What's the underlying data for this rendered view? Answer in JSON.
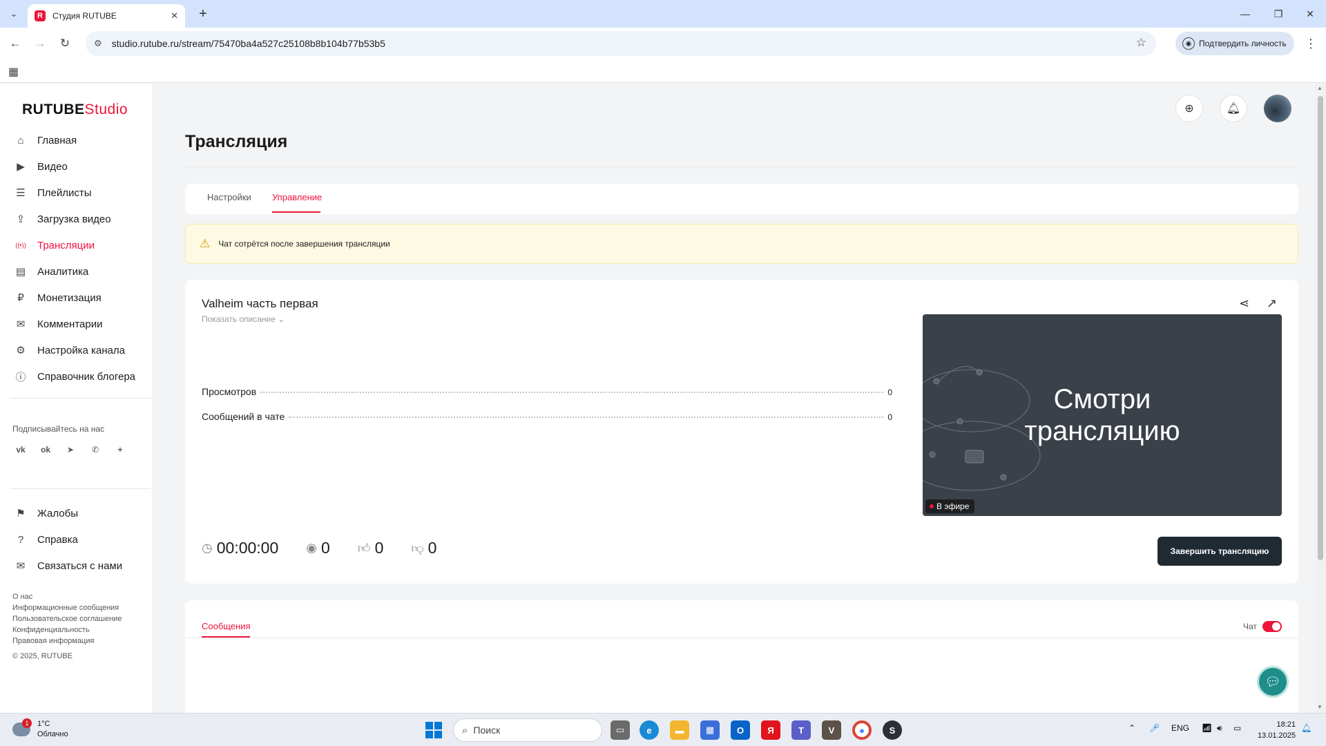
{
  "browser": {
    "tab_title": "Студия RUTUBE",
    "tab_favicon": "R",
    "url": "studio.rutube.ru/stream/75470ba4a527c25108b8b104b77b53b5",
    "verify_label": "Подтвердить личность"
  },
  "logo": {
    "brand": "RUTUBE",
    "product": "Studio"
  },
  "sidebar": {
    "items": [
      {
        "label": "Главная",
        "icon": "home-icon",
        "glyph": "⌂"
      },
      {
        "label": "Видео",
        "icon": "video-icon",
        "glyph": "▶"
      },
      {
        "label": "Плейлисты",
        "icon": "playlist-icon",
        "glyph": "☰"
      },
      {
        "label": "Загрузка видео",
        "icon": "upload-icon",
        "glyph": "⇪"
      },
      {
        "label": "Трансляции",
        "icon": "broadcast-icon",
        "glyph": "((•))"
      },
      {
        "label": "Аналитика",
        "icon": "analytics-icon",
        "glyph": "▤"
      },
      {
        "label": "Монетизация",
        "icon": "ruble-icon",
        "glyph": "₽"
      },
      {
        "label": "Комментарии",
        "icon": "comments-icon",
        "glyph": "✉"
      },
      {
        "label": "Настройка канала",
        "icon": "gear-icon",
        "glyph": "⚙"
      },
      {
        "label": "Справочник блогера",
        "icon": "info-icon",
        "glyph": "ⓘ"
      }
    ],
    "active_index": 4,
    "follow_label": "Подписывайтесь на нас",
    "socials": [
      {
        "icon": "vk-icon",
        "glyph": "vk"
      },
      {
        "icon": "ok-icon",
        "glyph": "ok"
      },
      {
        "icon": "telegram-icon",
        "glyph": "➤"
      },
      {
        "icon": "viber-icon",
        "glyph": "✆"
      },
      {
        "icon": "plus-icon",
        "glyph": "+"
      }
    ],
    "secondary": [
      {
        "label": "Жалобы",
        "icon": "flag-icon",
        "glyph": "⚑"
      },
      {
        "label": "Справка",
        "icon": "help-icon",
        "glyph": "?"
      },
      {
        "label": "Связаться с нами",
        "icon": "mail-icon",
        "glyph": "✉"
      }
    ],
    "footer_links": [
      "О нас",
      "Информационные сообщения",
      "Пользовательское соглашение",
      "Конфиденциальность",
      "Правовая информация"
    ],
    "copyright": "© 2025, RUTUBE"
  },
  "page": {
    "title": "Трансляция",
    "tabs": [
      "Настройки",
      "Управление"
    ],
    "active_tab": 1,
    "alert": "Чат сотрётся после завершения трансляции"
  },
  "stream": {
    "title": "Valheim часть первая",
    "show_description": "Показать описание",
    "stats": [
      {
        "label": "Просмотров",
        "value": "0"
      },
      {
        "label": "Сообщений в чате",
        "value": "0"
      }
    ],
    "preview_text_line1": "Смотри",
    "preview_text_line2": "трансляцию",
    "live_badge": "В эфире",
    "duration": "00:00:00",
    "viewers": "0",
    "likes": "0",
    "dislikes": "0",
    "end_button": "Завершить трансляцию"
  },
  "messages": {
    "tab": "Сообщения",
    "chat_label": "Чат",
    "chat_enabled": true
  },
  "taskbar": {
    "temperature": "1°C",
    "weather": "Облачно",
    "weather_badge": "1",
    "search_placeholder": "Поиск",
    "lang": "ENG",
    "time": "18:21",
    "date": "13.01.2025"
  },
  "colors": {
    "accent": "#ed143b",
    "dark_button": "#1f2a33",
    "alert_bg": "#fef9e3"
  }
}
